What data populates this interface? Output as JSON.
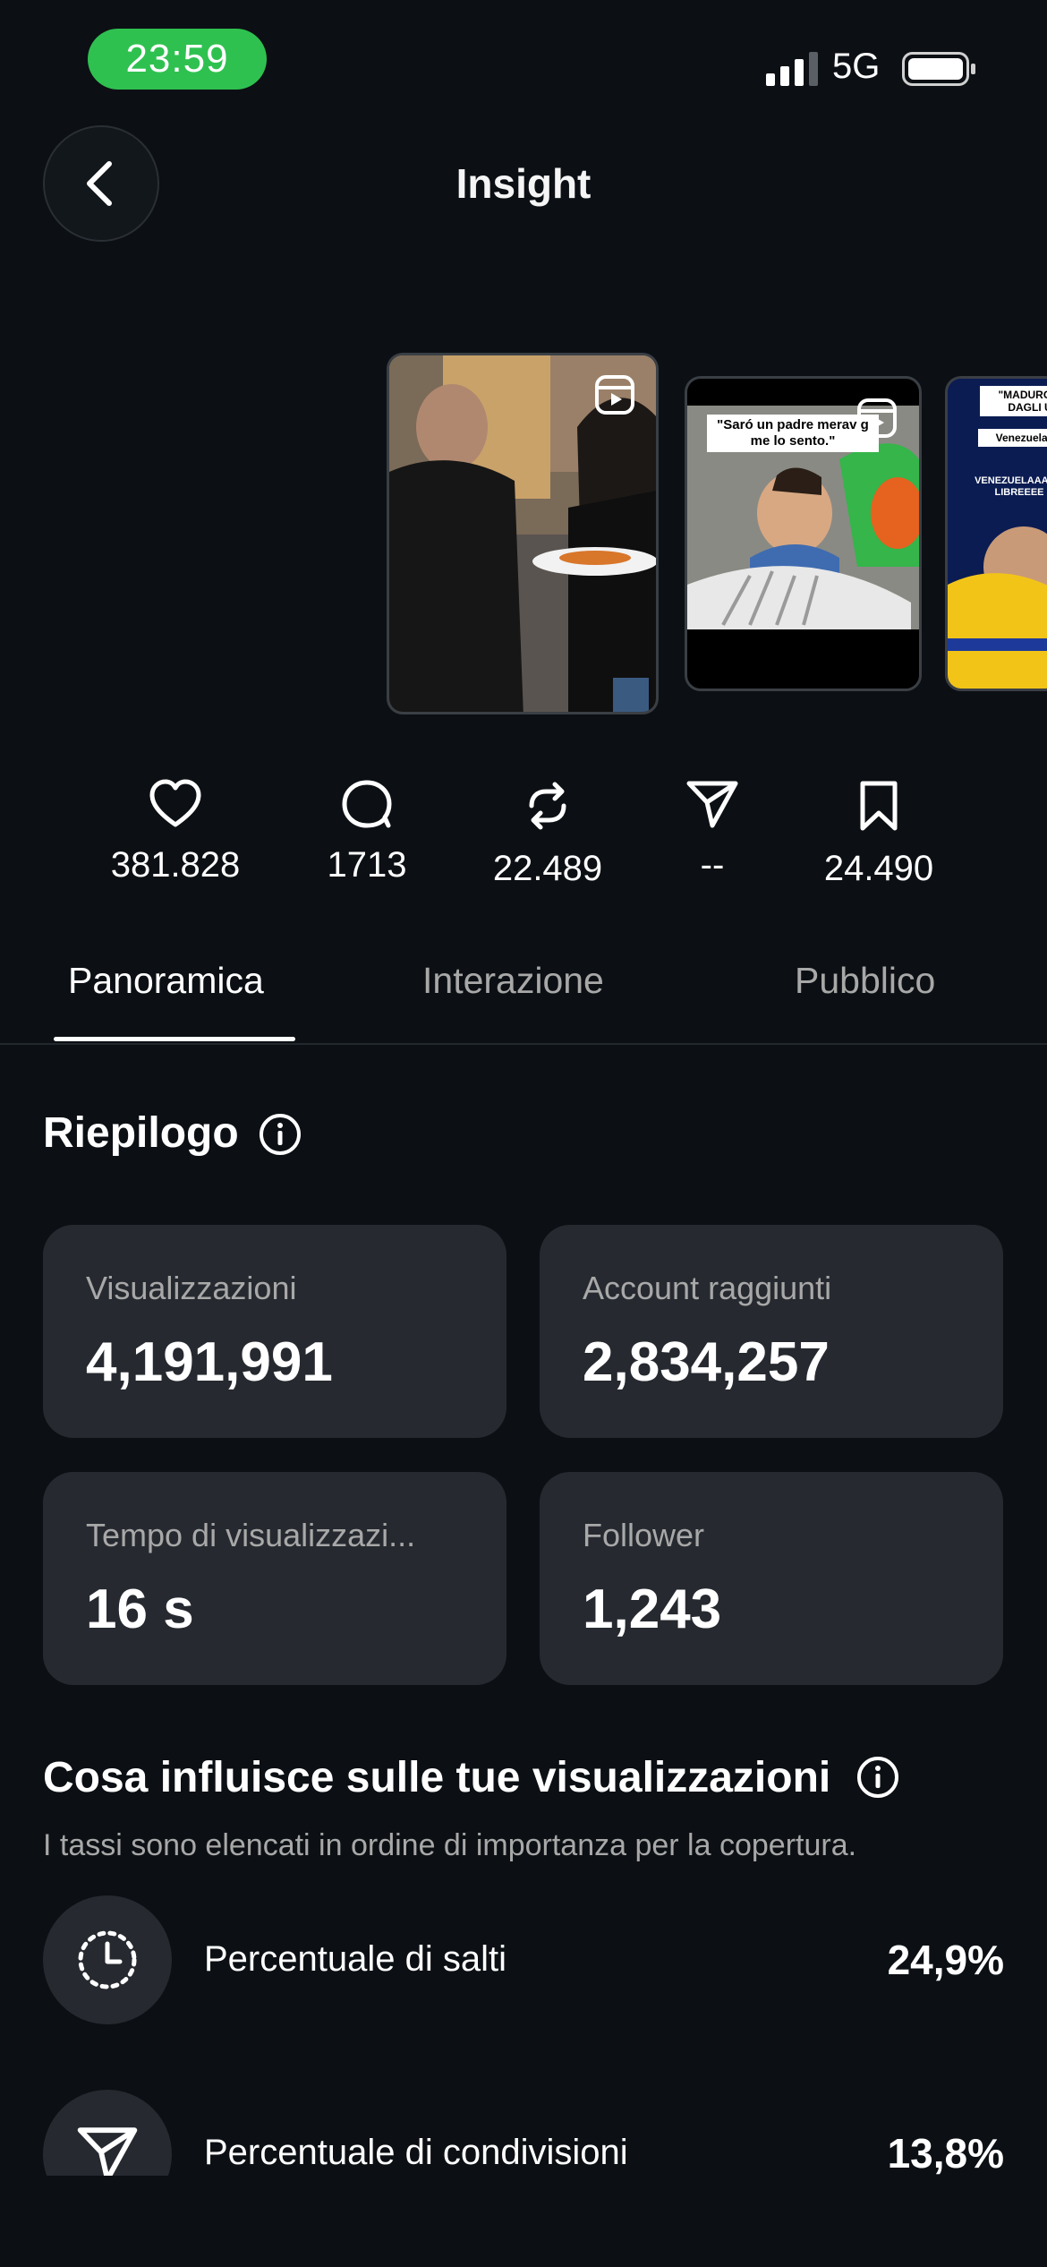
{
  "status_bar": {
    "time": "23:59",
    "network": "5G"
  },
  "header": {
    "title": "Insight"
  },
  "thumbnails": {
    "second_caption": "\"Saró un padre meravig me lo sento.\"",
    "third_caption": "\"MADURO V DAGLI U",
    "third_sub": "Venezuelani:",
    "third_overlay": "VENEZUELAAA ES LIBREEEE"
  },
  "metrics": [
    {
      "icon": "heart-icon",
      "value": "381.828"
    },
    {
      "icon": "comment-icon",
      "value": "1713"
    },
    {
      "icon": "repost-icon",
      "value": "22.489"
    },
    {
      "icon": "share-icon",
      "value": "--"
    },
    {
      "icon": "save-icon",
      "value": "24.490"
    }
  ],
  "tabs": [
    {
      "label": "Panoramica",
      "active": true
    },
    {
      "label": "Interazione",
      "active": false
    },
    {
      "label": "Pubblico",
      "active": false
    }
  ],
  "summary": {
    "title": "Riepilogo",
    "cards": [
      {
        "label": "Visualizzazioni",
        "value": "4,191,991"
      },
      {
        "label": "Account raggiunti",
        "value": "2,834,257"
      },
      {
        "label": "Tempo di visualizzazi...",
        "value": "16 s"
      },
      {
        "label": "Follower",
        "value": "1,243"
      }
    ]
  },
  "influence": {
    "title": "Cosa influisce sulle tue visualizzazioni",
    "subtitle": "I tassi sono elencati in ordine di importanza per la copertura.",
    "rates": [
      {
        "icon": "timer-icon",
        "label": "Percentuale di salti",
        "value": "24,9%"
      },
      {
        "icon": "share-icon",
        "label": "Percentuale di condivisioni",
        "value": "13,8%"
      }
    ]
  },
  "colors": {
    "background": "#0c1014",
    "card": "#262a30",
    "time_pill": "#2fc150",
    "muted": "#a8a8a8"
  }
}
